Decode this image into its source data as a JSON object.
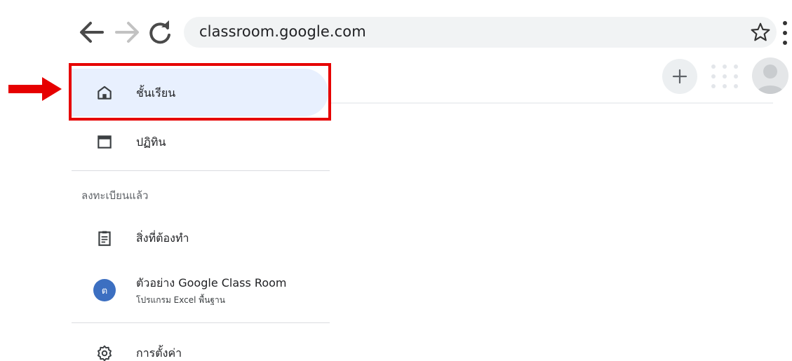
{
  "browser": {
    "url": "classroom.google.com",
    "back_icon": "arrow-left-icon",
    "forward_icon": "arrow-right-icon",
    "reload_icon": "reload-icon",
    "bookmark_icon": "star-outline-icon",
    "menu_icon": "kebab-menu-icon"
  },
  "header": {
    "create_icon": "plus-icon",
    "apps_icon": "apps-grid-icon",
    "account_icon": "account-avatar"
  },
  "sidebar": {
    "items": [
      {
        "label": "ชั้นเรียน",
        "icon": "home-icon",
        "active": true
      },
      {
        "label": "ปฏิทิน",
        "icon": "calendar-icon",
        "active": false
      }
    ],
    "enrolled_section": {
      "title": "ลงทะเบียนแล้ว",
      "todo_label": "สิ่งที่ต้องทำ",
      "todo_icon": "clipboard-icon",
      "class": {
        "avatar_letter": "ต",
        "title": "ตัวอย่าง Google Class Room",
        "subtitle": "โปรแกรม Excel พื้นฐาน"
      }
    },
    "settings_label": "การตั้งค่า",
    "settings_icon": "gear-icon"
  },
  "annotation": {
    "color": "#e60000"
  }
}
